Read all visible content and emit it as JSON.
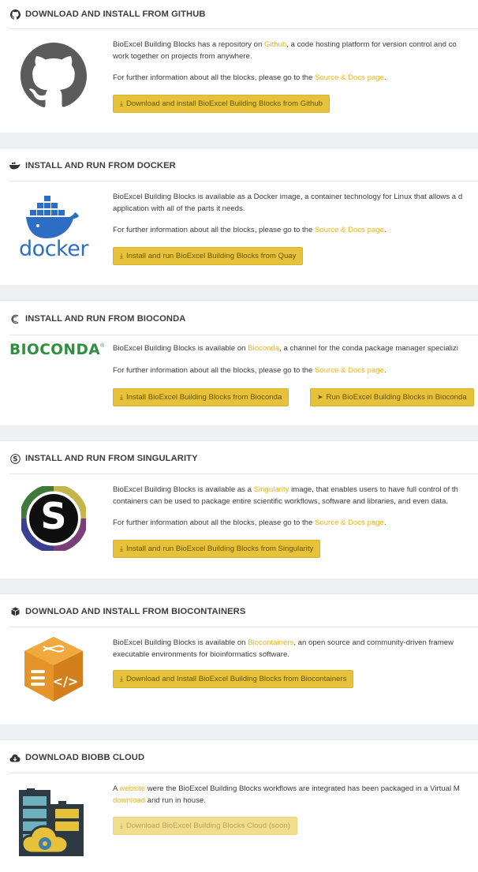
{
  "sections": [
    {
      "title": "DOWNLOAD AND INSTALL FROM GITHUB",
      "header_icon": "github-icon",
      "logo": "github-logo",
      "text1_pre": "BioExcel Building Blocks has a repository on ",
      "text1_link": "Github",
      "text1_post": ", a code hosting platform for version control and co",
      "text1_line2": "work together on projects from anywhere.",
      "text2_pre": "For further information about all the blocks, please go to the ",
      "text2_link": "Source & Docs page",
      "text2_post": ".",
      "button": "Download and install BioExcel Building Blocks from Github"
    },
    {
      "title": "INSTALL AND RUN FROM DOCKER",
      "header_icon": "docker-icon",
      "logo": "docker-logo",
      "logo_text": "docker",
      "text1_pre": "BioExcel Building Blocks is available as a Docker image, a container technology for Linux that allows a d",
      "text1_line2": "application with all of the parts it needs.",
      "text2_pre": "For further information about all the blocks, please go to the ",
      "text2_link": "Source & Docs page",
      "text2_post": ".",
      "button": "Install and run BioExcel Building Blocks from Quay"
    },
    {
      "title": "INSTALL AND RUN FROM BIOCONDA",
      "header_icon": "bioconda-icon",
      "logo": "bioconda-logo",
      "logo_text": "BIOCONDA",
      "logo_mark": "®",
      "text1_pre": "BioExcel Building Blocks is available on ",
      "text1_link": "Bioconda",
      "text1_post": ", a channel for the conda package manager specializi",
      "text2_pre": "For further information about all the blocks, please go to the ",
      "text2_link": "Source & Docs page",
      "text2_post": ".",
      "button": "Install BioExcel Building Blocks from Bioconda",
      "button2": "Run BioExcel Building Blocks in Bioconda"
    },
    {
      "title": "INSTALL AND RUN FROM SINGULARITY",
      "header_icon": "singularity-icon",
      "logo": "singularity-logo",
      "logo_text": "S",
      "text1_pre": "BioExcel Building Blocks is available as a ",
      "text1_link": "Singularity",
      "text1_post": " image, that enables users to have full control of th",
      "text1_line2": "containers can be used to package entire scientific workflows, software and libraries, and even data.",
      "text2_pre": "For further information about all the blocks, please go to the ",
      "text2_link": "Source & Docs page",
      "text2_post": ".",
      "button": "Install and run BioExcel Building Blocks from Singularity"
    },
    {
      "title": "DOWNLOAD AND INSTALL FROM BIOCONTAINERS",
      "header_icon": "cube-icon",
      "logo": "biocontainers-logo",
      "text1_pre": "BioExcel Building Blocks is available on ",
      "text1_link": "Biocontainers",
      "text1_post": ", an open source and community-driven framew",
      "text1_line2": "executable environments for bioinformatics software.",
      "button": "Download and Install BioExcel Building Blocks from Biocontainers"
    },
    {
      "title": "DOWNLOAD BIOBB CLOUD",
      "header_icon": "cloud-download-icon",
      "logo": "biobb-cloud-logo",
      "text1_pre": "A ",
      "text1_link": "website",
      "text1_post": " were the BioExcel Building Blocks workflows are integrated has been packaged in a Virtual M",
      "text1_line2_link": "download",
      "text1_line2_post": " and run in house.",
      "button": "Download BioExcel Building Blocks Cloud (soon)",
      "button_disabled": true
    }
  ],
  "colors": {
    "accent": "#e8b417",
    "button_bg": "#e6c23a",
    "gap_bg": "#eef1f4"
  }
}
